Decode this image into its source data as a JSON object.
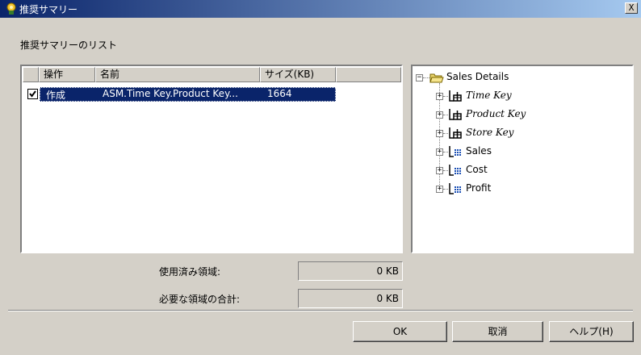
{
  "window": {
    "title": "推奨サマリー",
    "close_label": "X"
  },
  "section_label": "推奨サマリーのリスト",
  "list": {
    "headers": {
      "action": "操作",
      "name": "名前",
      "size": "サイズ(KB)"
    },
    "rows": [
      {
        "checked": true,
        "action": "作成",
        "name": "ASM.Time Key.Product Key...",
        "size": "1664"
      }
    ]
  },
  "tree": {
    "root": "Sales Details",
    "children": [
      {
        "label": "Time Key",
        "type": "dimension",
        "icon": "dimension-icon"
      },
      {
        "label": "Product Key",
        "type": "dimension",
        "icon": "dimension-icon"
      },
      {
        "label": "Store Key",
        "type": "dimension",
        "icon": "dimension-icon"
      },
      {
        "label": "Sales",
        "type": "measure",
        "icon": "measure-icon"
      },
      {
        "label": "Cost",
        "type": "measure",
        "icon": "measure-icon"
      },
      {
        "label": "Profit",
        "type": "measure",
        "icon": "measure-icon"
      }
    ]
  },
  "fields": {
    "used_label": "使用済み領域:",
    "used_value": "0 KB",
    "required_label": "必要な領域の合計:",
    "required_value": "0 KB"
  },
  "buttons": {
    "ok": "OK",
    "cancel": "取消",
    "help": "ヘルプ(H)"
  },
  "colors": {
    "selection": "#0a246a",
    "face": "#d4d0c8",
    "title_start": "#0a246a"
  }
}
